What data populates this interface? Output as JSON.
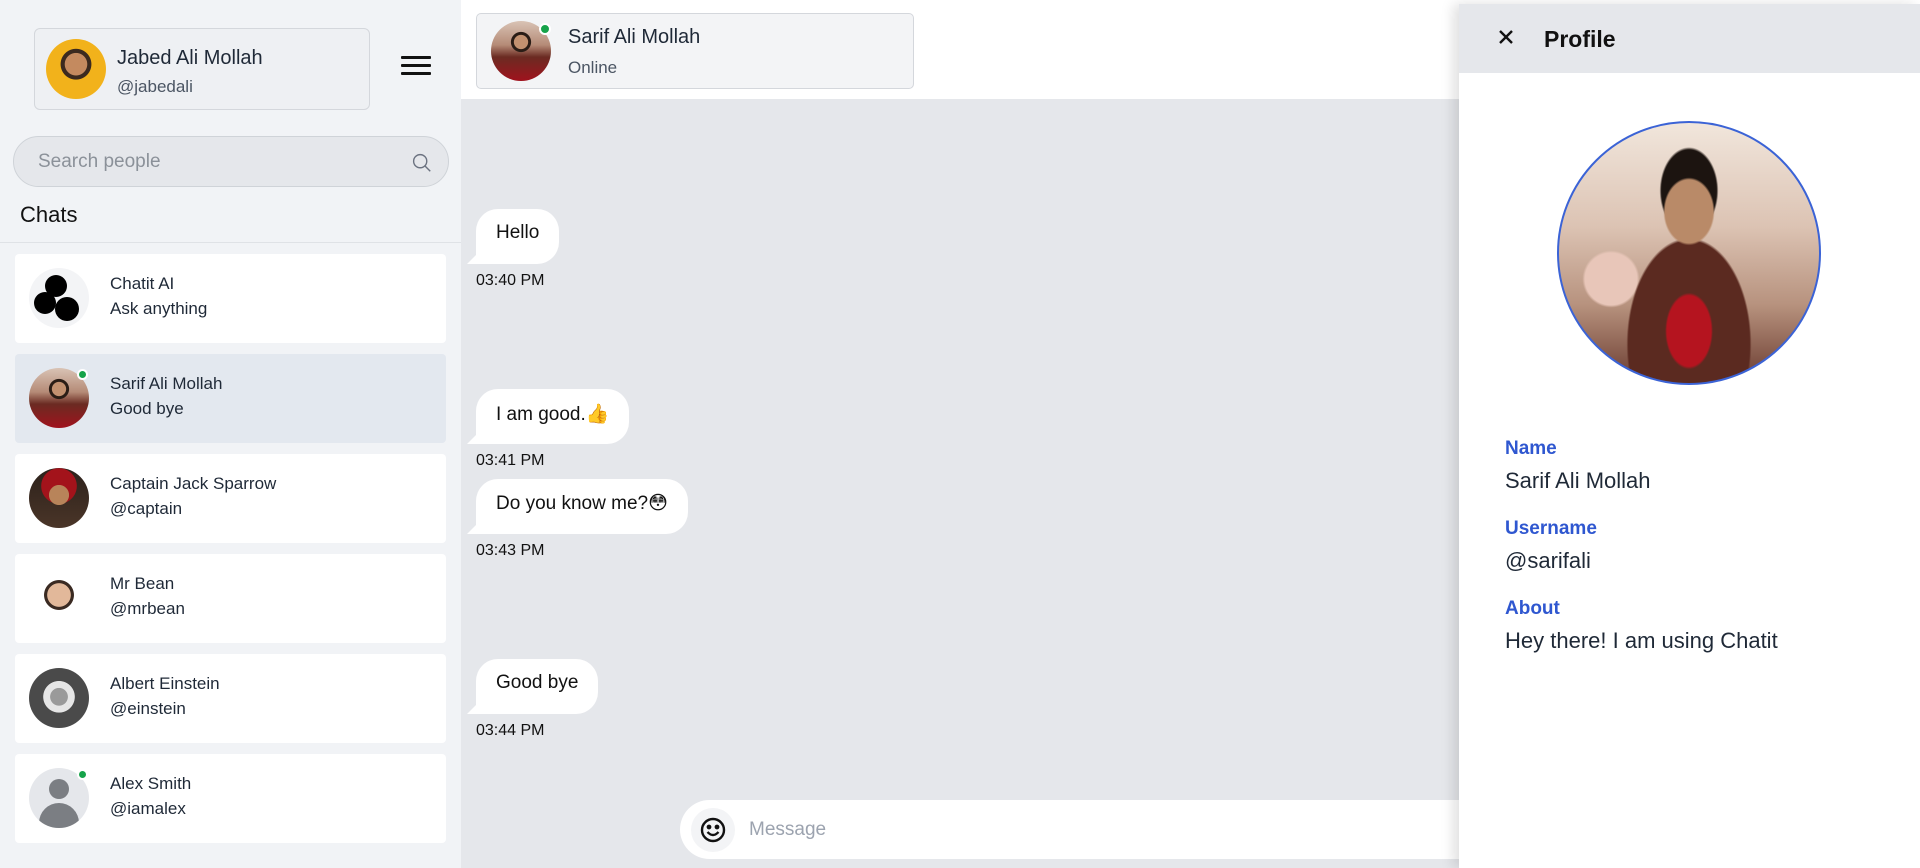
{
  "me": {
    "name": "Jabed Ali Mollah",
    "handle": "@jabedali"
  },
  "search": {
    "placeholder": "Search people"
  },
  "sidebar": {
    "chats_title": "Chats",
    "chats": [
      {
        "name": "Chatit AI",
        "sub": "Ask anything",
        "online": false
      },
      {
        "name": "Sarif Ali Mollah",
        "sub": "Good bye",
        "online": true,
        "active": true
      },
      {
        "name": "Captain Jack Sparrow",
        "sub": "@captain",
        "online": false
      },
      {
        "name": "Mr Bean",
        "sub": "@mrbean",
        "online": false
      },
      {
        "name": "Albert Einstein",
        "sub": "@einstein",
        "online": false
      },
      {
        "name": "Alex Smith",
        "sub": "@iamalex",
        "online": true
      }
    ]
  },
  "chat": {
    "contact": {
      "name": "Sarif Ali Mollah",
      "status": "Online"
    },
    "messages": [
      {
        "text": "Hello",
        "time": "03:40 PM"
      },
      {
        "text": "I am good.👍",
        "time": "03:41 PM"
      },
      {
        "text": "Do you know me?😳",
        "time": "03:43 PM"
      },
      {
        "text": "Good bye",
        "time": "03:44 PM"
      }
    ],
    "composer": {
      "placeholder": "Message"
    }
  },
  "profile": {
    "title": "Profile",
    "name_label": "Name",
    "name": "Sarif Ali Mollah",
    "username_label": "Username",
    "username": "@sarifali",
    "about_label": "About",
    "about": "Hey there! I am using Chatit"
  },
  "colors": {
    "accent": "#2f57d0",
    "online": "#16a34a",
    "chat_bg": "#e5e7eb",
    "sidebar_bg": "#f1f3f6"
  },
  "icons": {
    "menu": "hamburger-icon",
    "search": "search-icon",
    "emoji": "smiley-icon",
    "close": "close-icon"
  }
}
